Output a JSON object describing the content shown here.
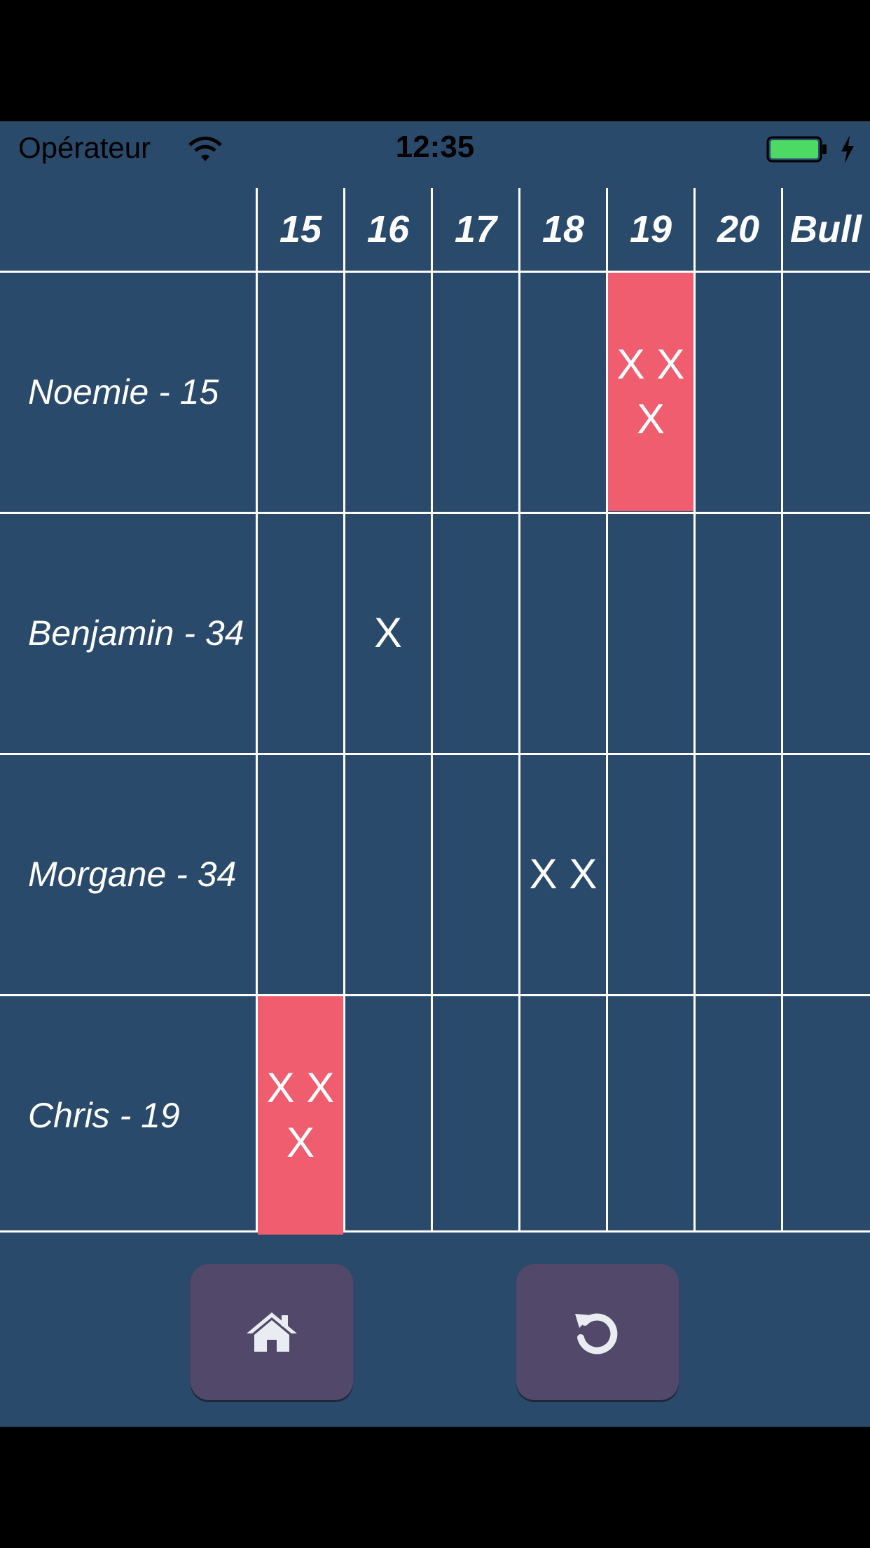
{
  "status_bar": {
    "carrier": "Opérateur",
    "time": "12:35",
    "battery_color": "#4cd964"
  },
  "columns": [
    "15",
    "16",
    "17",
    "18",
    "19",
    "20",
    "Bull"
  ],
  "players": [
    {
      "label": "Noemie - 15",
      "marks": [
        "",
        "",
        "",
        "",
        "XXX",
        "",
        ""
      ]
    },
    {
      "label": "Benjamin - 34",
      "marks": [
        "",
        "X",
        "",
        "",
        "",
        "",
        ""
      ]
    },
    {
      "label": "Morgane - 34",
      "marks": [
        "",
        "",
        "",
        "XX",
        "",
        "",
        ""
      ]
    },
    {
      "label": "Chris - 19",
      "marks": [
        "XXX",
        "",
        "",
        "",
        "",
        "",
        ""
      ]
    }
  ],
  "colors": {
    "background": "#2a4a6b",
    "closed_cell": "#f05d6f",
    "button": "#51486a"
  },
  "buttons": {
    "home_icon": "home-icon",
    "restart_icon": "restart-icon"
  }
}
